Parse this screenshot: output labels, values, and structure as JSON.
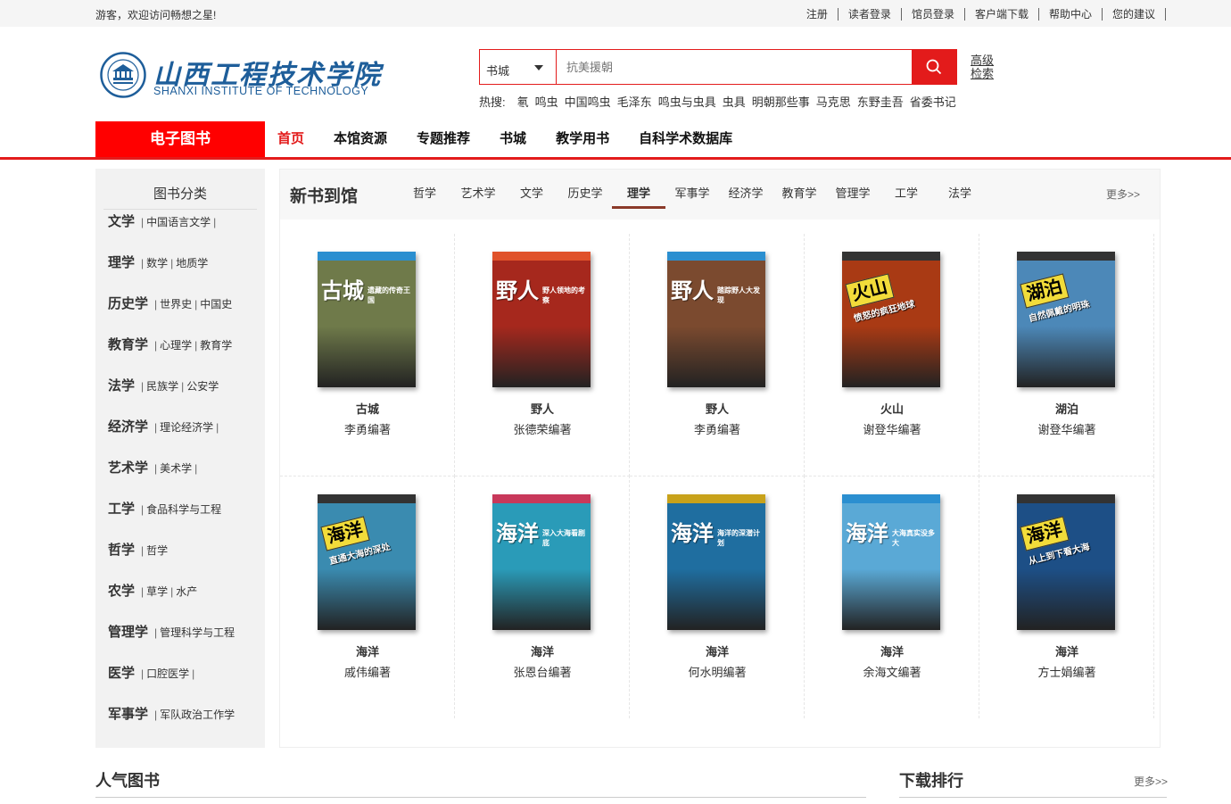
{
  "topbar": {
    "welcome": "游客，欢迎访问畅想之星!",
    "links": [
      "注册",
      "读者登录",
      "馆员登录",
      "客户端下载",
      "帮助中心",
      "您的建议"
    ]
  },
  "logo": {
    "name": "山西工程技术学院",
    "subtitle": "SHANXI INSTITUTE OF TECHNOLOGY"
  },
  "search": {
    "scope": "书城",
    "placeholder": "抗美援朝",
    "advanced_line1": "高级",
    "advanced_line2": "检索"
  },
  "hot": {
    "label": "热搜:",
    "terms": [
      "氡",
      "鸣虫",
      "中国鸣虫",
      "毛泽东",
      "鸣虫与虫具",
      "虫具",
      "明朝那些事",
      "马克思",
      "东野圭吾",
      "省委书记"
    ]
  },
  "nav": {
    "category_label": "电子图书",
    "items": [
      "首页",
      "本馆资源",
      "专题推荐",
      "书城",
      "教学用书",
      "自科学术数据库"
    ],
    "active": "首页"
  },
  "sidebar": {
    "title": "图书分类",
    "rows": [
      {
        "main": "文学",
        "subs": [
          "中国语言文学"
        ],
        "trail": true
      },
      {
        "main": "理学",
        "subs": [
          "数学",
          "地质学"
        ],
        "trail": false
      },
      {
        "main": "历史学",
        "subs": [
          "世界史",
          "中国史"
        ],
        "trail": false
      },
      {
        "main": "教育学",
        "subs": [
          "心理学",
          "教育学"
        ],
        "trail": false
      },
      {
        "main": "法学",
        "subs": [
          "民族学",
          "公安学"
        ],
        "trail": false
      },
      {
        "main": "经济学",
        "subs": [
          "理论经济学"
        ],
        "trail": true
      },
      {
        "main": "艺术学",
        "subs": [
          "美术学"
        ],
        "trail": true
      },
      {
        "main": "工学",
        "subs": [
          "食品科学与工程"
        ],
        "trail": false
      },
      {
        "main": "哲学",
        "subs": [
          "哲学"
        ],
        "trail": false
      },
      {
        "main": "农学",
        "subs": [
          "草学",
          "水产"
        ],
        "trail": false
      },
      {
        "main": "管理学",
        "subs": [
          "管理科学与工程"
        ],
        "trail": false
      },
      {
        "main": "医学",
        "subs": [
          "口腔医学"
        ],
        "trail": true
      },
      {
        "main": "军事学",
        "subs": [
          "军队政治工作学"
        ],
        "trail": false
      }
    ]
  },
  "panel": {
    "title": "新书到馆",
    "tabs": [
      "哲学",
      "艺术学",
      "文学",
      "历史学",
      "理学",
      "军事学",
      "经济学",
      "教育学",
      "管理学",
      "工学",
      "法学"
    ],
    "active_tab": "理学",
    "more": "更多>>",
    "books": [
      {
        "title": "古城",
        "author": "李勇编著",
        "cover_big": "古城",
        "cover_small": "遗藏的传奇王国",
        "band": "#2b8fd0",
        "bg": "#6f7a4a",
        "style": "top"
      },
      {
        "title": "野人",
        "author": "张德荣编著",
        "cover_big": "野人",
        "cover_small": "野人领地的考察",
        "band": "#e0522a",
        "bg": "#a6281d",
        "style": "top"
      },
      {
        "title": "野人",
        "author": "李勇编著",
        "cover_big": "野人",
        "cover_small": "踏踪野人大发现",
        "band": "#2b8fd0",
        "bg": "#7b4a2f",
        "style": "top"
      },
      {
        "title": "火山",
        "author": "谢登华编著",
        "cover_big": "火山",
        "cover_small": "愤怒的疯狂地球",
        "band": "#333333",
        "bg": "#a93a14",
        "style": "tag"
      },
      {
        "title": "湖泊",
        "author": "谢登华编著",
        "cover_big": "湖泊",
        "cover_small": "自然佩戴的明珠",
        "band": "#333333",
        "bg": "#4c88b8",
        "style": "tag"
      },
      {
        "title": "海洋",
        "author": "戚伟编著",
        "cover_big": "海洋",
        "cover_small": "直通大海的深处",
        "band": "#333333",
        "bg": "#3a8bb0",
        "style": "tag"
      },
      {
        "title": "海洋",
        "author": "张恩台编著",
        "cover_big": "海洋",
        "cover_small": "深入大海看剧底",
        "band": "#c8385a",
        "bg": "#2a9bb8",
        "style": "top"
      },
      {
        "title": "海洋",
        "author": "何水明编著",
        "cover_big": "海洋",
        "cover_small": "海洋的深潜计划",
        "band": "#c8a21a",
        "bg": "#1f6ea0",
        "style": "top"
      },
      {
        "title": "海洋",
        "author": "余海文编著",
        "cover_big": "海洋",
        "cover_small": "大海真实没多大",
        "band": "#2b8fd0",
        "bg": "#5aa9d6",
        "style": "top"
      },
      {
        "title": "海洋",
        "author": "方士娟编著",
        "cover_big": "海洋",
        "cover_small": "从上到下看大海",
        "band": "#333333",
        "bg": "#1d4f86",
        "style": "tag"
      }
    ]
  },
  "bottom": {
    "popular": "人气图书",
    "downloads": "下载排行",
    "more": "更多>>"
  },
  "colors": {
    "accent": "#e31b1b",
    "nav_category_bg": "#ff0000",
    "logo_blue": "#1e5e9a",
    "active_tab_underline": "#8b3a2a"
  }
}
